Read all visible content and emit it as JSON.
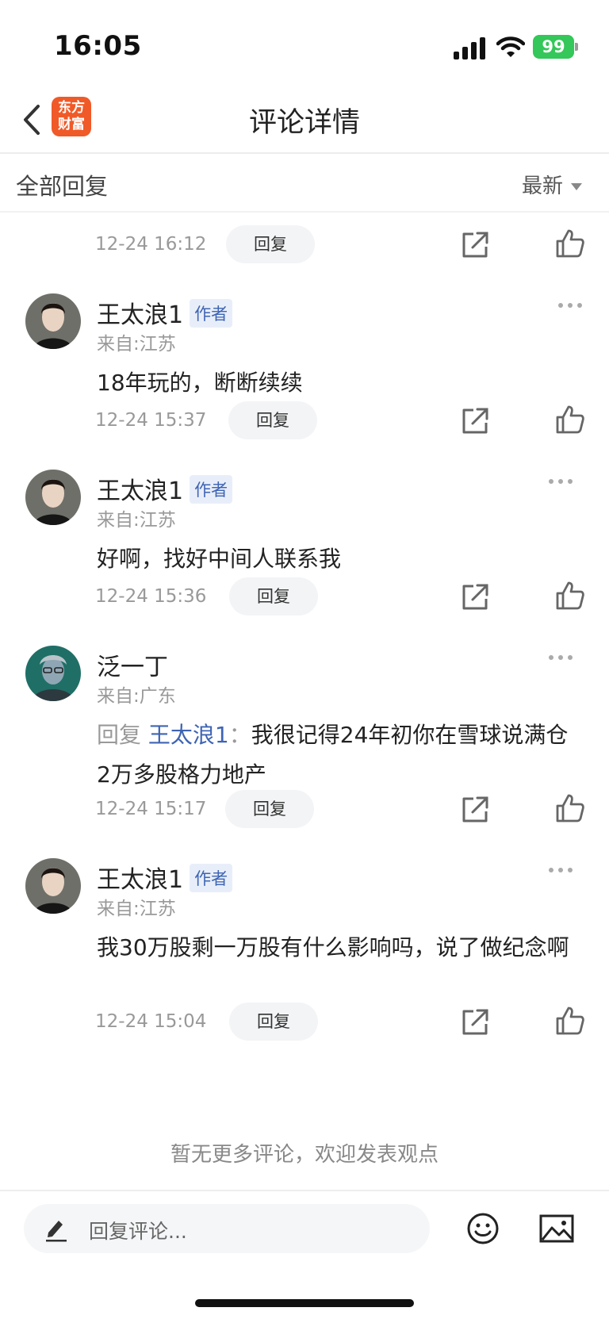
{
  "status": {
    "time": "16:05",
    "battery": "99"
  },
  "nav": {
    "logo_line1": "东方",
    "logo_line2": "财富",
    "title": "评论详情"
  },
  "filter": {
    "label": "全部回复",
    "sort": "最新"
  },
  "top_action": {
    "time": "12-24 16:12",
    "reply_label": "回复"
  },
  "comments": [
    {
      "username": "王太浪1",
      "badge": "作者",
      "location": "来自:江苏",
      "content": "18年玩的，断断续续",
      "time": "12-24 15:37",
      "reply_label": "回复"
    },
    {
      "username": "王太浪1",
      "badge": "作者",
      "location": "来自:江苏",
      "content": "好啊，找好中间人联系我",
      "time": "12-24 15:36",
      "reply_label": "回复"
    },
    {
      "username": "泛一丁",
      "location": "来自:广东",
      "reply_prefix": "回复 ",
      "reply_to": "王太浪1",
      "reply_sep": "：",
      "content": "我很记得24年初你在雪球说满仓2万多股格力地产",
      "time": "12-24 15:17",
      "reply_label": "回复"
    },
    {
      "username": "王太浪1",
      "badge": "作者",
      "location": "来自:江苏",
      "content": "我30万股剩一万股有什么影响吗，说了做纪念啊",
      "time": "12-24 15:04",
      "reply_label": "回复"
    }
  ],
  "footer": {
    "no_more": "暂无更多评论，欢迎发表观点"
  },
  "bottom": {
    "input_placeholder": "回复评论..."
  },
  "colors": {
    "accent_blue": "#3e64b3",
    "brand_orange": "#f05a28",
    "battery_green": "#34c759"
  },
  "icons": [
    "back-icon",
    "share-icon",
    "like-icon",
    "more-icon",
    "pencil-icon",
    "emoji-icon",
    "image-icon"
  ]
}
